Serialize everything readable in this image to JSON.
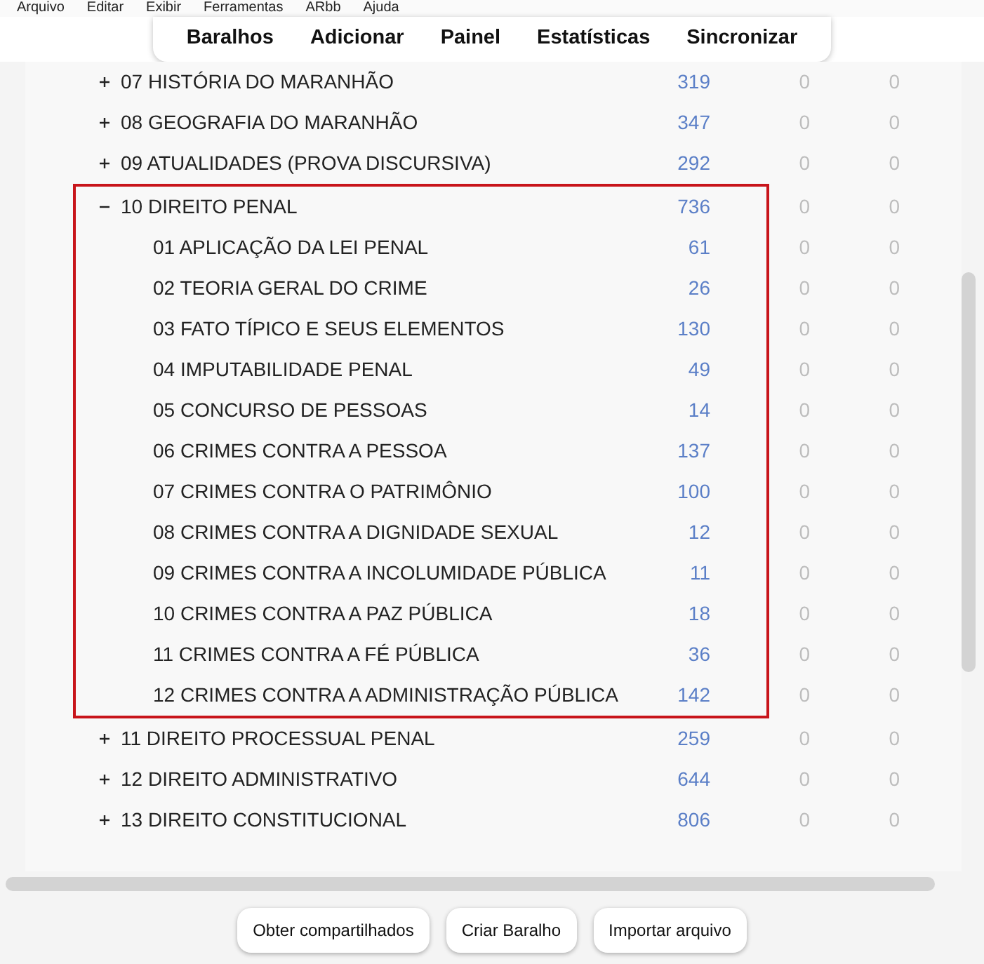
{
  "menu": [
    "Arquivo",
    "Editar",
    "Exibir",
    "Ferramentas",
    "ARbb",
    "Ajuda"
  ],
  "toolbar": [
    "Baralhos",
    "Adicionar",
    "Painel",
    "Estatísticas",
    "Sincronizar"
  ],
  "decks": [
    {
      "name": "07 HISTÓRIA DO MARANHÃO",
      "count": "319",
      "column_3": "0",
      "column_4": "0",
      "expanded": false,
      "highlighted": false
    },
    {
      "name": "08 GEOGRAFIA DO MARANHÃO",
      "count": "347",
      "column_3": "0",
      "column_4": "0",
      "expanded": false,
      "highlighted": false
    },
    {
      "name": "09 ATUALIDADES (PROVA DISCURSIVA)",
      "count": "292",
      "column_3": "0",
      "column_4": "0",
      "expanded": false,
      "highlighted": false
    },
    {
      "name": "10 DIREITO PENAL",
      "count": "736",
      "column_3": "0",
      "column_4": "0",
      "expanded": true,
      "highlighted": true,
      "children": [
        {
          "name": "01 APLICAÇÃO DA LEI PENAL",
          "count": "61",
          "column_3": "0",
          "column_4": "0"
        },
        {
          "name": "02 TEORIA GERAL DO CRIME",
          "count": "26",
          "column_3": "0",
          "column_4": "0"
        },
        {
          "name": "03 FATO TÍPICO E SEUS ELEMENTOS",
          "count": "130",
          "column_3": "0",
          "column_4": "0"
        },
        {
          "name": "04 IMPUTABILIDADE PENAL",
          "count": "49",
          "column_3": "0",
          "column_4": "0"
        },
        {
          "name": "05 CONCURSO DE PESSOAS",
          "count": "14",
          "column_3": "0",
          "column_4": "0"
        },
        {
          "name": "06 CRIMES CONTRA A PESSOA",
          "count": "137",
          "column_3": "0",
          "column_4": "0"
        },
        {
          "name": "07 CRIMES CONTRA O PATRIMÔNIO",
          "count": "100",
          "column_3": "0",
          "column_4": "0"
        },
        {
          "name": "08 CRIMES CONTRA A DIGNIDADE SEXUAL",
          "count": "12",
          "column_3": "0",
          "column_4": "0"
        },
        {
          "name": "09 CRIMES CONTRA A INCOLUMIDADE PÚBLICA",
          "count": "11",
          "column_3": "0",
          "column_4": "0"
        },
        {
          "name": "10 CRIMES CONTRA A PAZ PÚBLICA",
          "count": "18",
          "column_3": "0",
          "column_4": "0"
        },
        {
          "name": "11 CRIMES CONTRA A FÉ PÚBLICA",
          "count": "36",
          "column_3": "0",
          "column_4": "0"
        },
        {
          "name": "12 CRIMES CONTRA A ADMINISTRAÇÃO PÚBLICA",
          "count": "142",
          "column_3": "0",
          "column_4": "0"
        }
      ]
    },
    {
      "name": "11 DIREITO PROCESSUAL PENAL",
      "count": "259",
      "column_3": "0",
      "column_4": "0",
      "expanded": false,
      "highlighted": false
    },
    {
      "name": "12 DIREITO ADMINISTRATIVO",
      "count": "644",
      "column_3": "0",
      "column_4": "0",
      "expanded": false,
      "highlighted": false
    },
    {
      "name": "13 DIREITO CONSTITUCIONAL",
      "count": "806",
      "column_3": "0",
      "column_4": "0",
      "expanded": false,
      "highlighted": false
    }
  ],
  "buttons": [
    "Obter compartilhados",
    "Criar Baralho",
    "Importar arquivo"
  ]
}
